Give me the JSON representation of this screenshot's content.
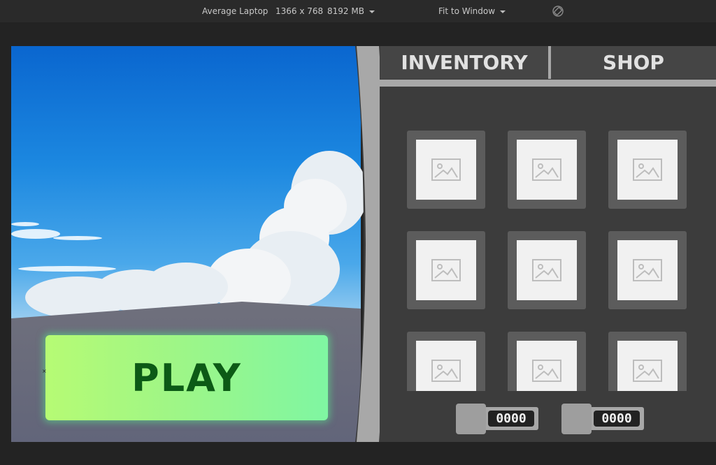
{
  "toolbar": {
    "device": "Average Laptop",
    "resolution": "1366 x 768",
    "memory": "8192 MB",
    "fit": "Fit to Window",
    "rotate_icon": "rotate-screen-icon"
  },
  "game": {
    "play_label": "PLAY",
    "tabs": {
      "inventory": "INVENTORY",
      "shop": "SHOP"
    },
    "slots": [
      {
        "icon": "image-placeholder-icon"
      },
      {
        "icon": "image-placeholder-icon"
      },
      {
        "icon": "image-placeholder-icon"
      },
      {
        "icon": "image-placeholder-icon"
      },
      {
        "icon": "image-placeholder-icon"
      },
      {
        "icon": "image-placeholder-icon"
      },
      {
        "icon": "image-placeholder-icon"
      },
      {
        "icon": "image-placeholder-icon"
      },
      {
        "icon": "image-placeholder-icon"
      }
    ],
    "counters": [
      {
        "value": "0000"
      },
      {
        "value": "0000"
      }
    ]
  },
  "colors": {
    "play_green": "#9ff686",
    "play_text": "#0c5a16",
    "panel_bg": "#3c3c3c",
    "slot_frame": "#5c5c5c",
    "divider_gray": "#a8a8a8"
  }
}
